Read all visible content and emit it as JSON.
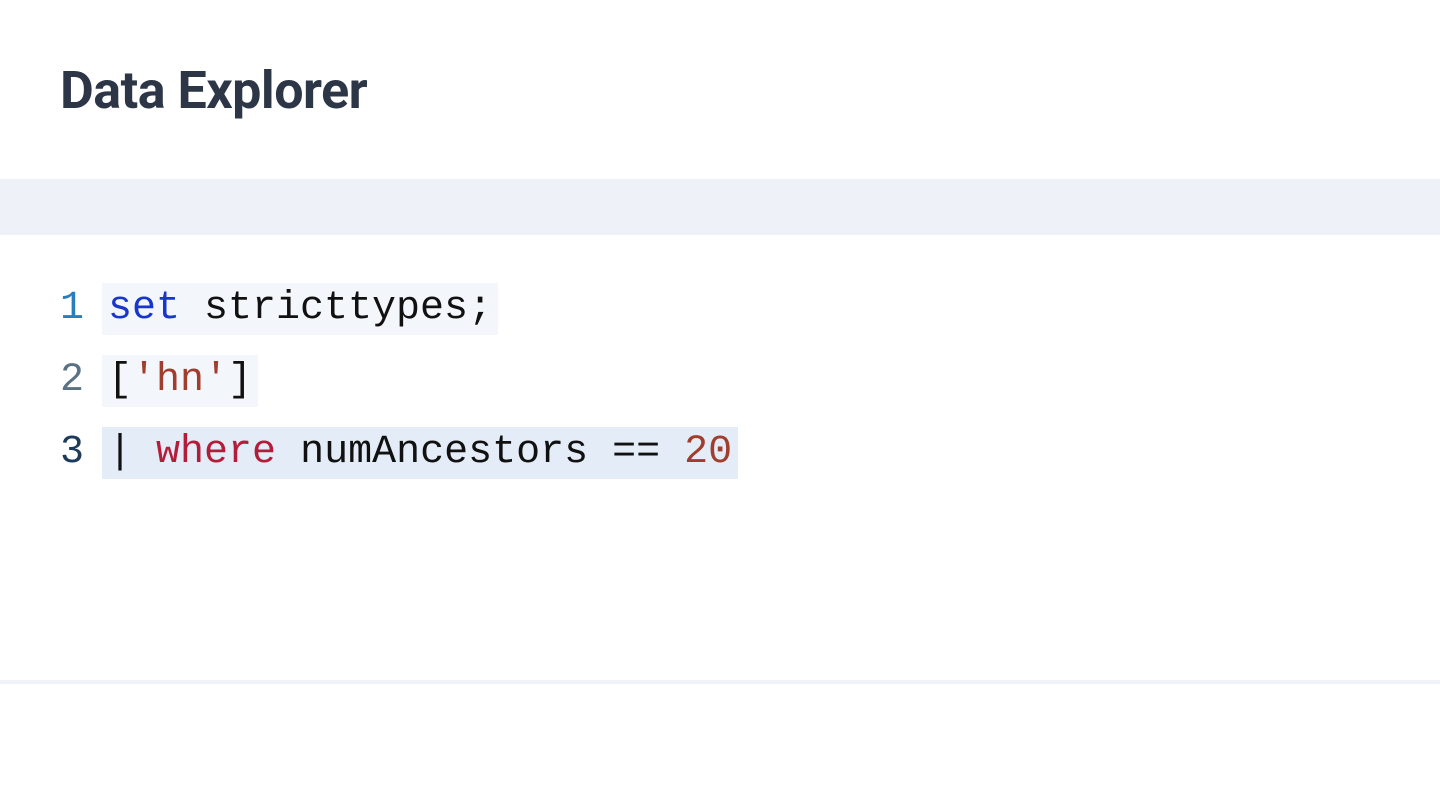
{
  "header": {
    "title": "Data Explorer"
  },
  "editor": {
    "lines": [
      {
        "n": "1",
        "selected": true,
        "sel_variant": "light",
        "tokens": [
          {
            "cls": "tok-keyword",
            "text": "set"
          },
          {
            "cls": "tok-plain",
            "text": " stricttypes;"
          }
        ]
      },
      {
        "n": "2",
        "selected": true,
        "sel_variant": "light",
        "tokens": [
          {
            "cls": "tok-plain",
            "text": "["
          },
          {
            "cls": "tok-string",
            "text": "'hn'"
          },
          {
            "cls": "tok-plain",
            "text": "]"
          }
        ]
      },
      {
        "n": "3",
        "selected": true,
        "sel_variant": "blue",
        "current": true,
        "tokens": [
          {
            "cls": "tok-pipe",
            "text": "| "
          },
          {
            "cls": "tok-operator",
            "text": "where"
          },
          {
            "cls": "tok-plain",
            "text": " "
          },
          {
            "cls": "tok-ident",
            "text": "numAncestors"
          },
          {
            "cls": "tok-plain",
            "text": " == "
          },
          {
            "cls": "tok-number",
            "text": "20"
          }
        ]
      }
    ]
  }
}
